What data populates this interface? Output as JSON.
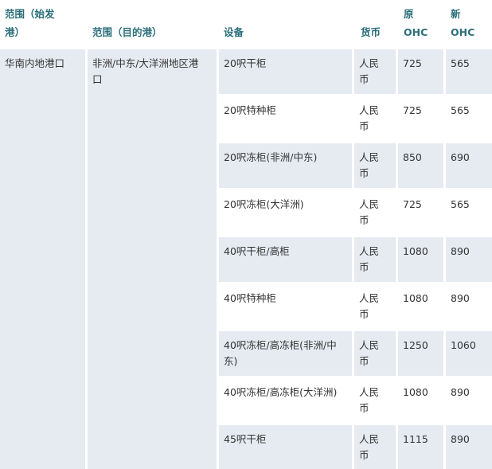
{
  "headers": {
    "origin": "范围（始发\n港）",
    "destination": "范围（目的港）",
    "equipment": "设备",
    "currency": "货币",
    "old_ohc": "原\nOHC",
    "new_ohc": "新\nOHC"
  },
  "origin_region": "华南内地港口",
  "destination_region": "非洲/中东/大洋洲地区港\n口",
  "rows": [
    {
      "equipment": "20呎干柜",
      "currency": "人民\n币",
      "old": "725",
      "new": "565"
    },
    {
      "equipment": "20呎特种柜",
      "currency": "人民\n币",
      "old": "725",
      "new": "565"
    },
    {
      "equipment": "20呎冻柜(非洲/中东)",
      "currency": "人民\n币",
      "old": "850",
      "new": "690"
    },
    {
      "equipment": "20呎冻柜(大洋洲)",
      "currency": "人民\n币",
      "old": "725",
      "new": "565"
    },
    {
      "equipment": "40呎干柜/高柜",
      "currency": "人民\n币",
      "old": "1080",
      "new": "890"
    },
    {
      "equipment": "40呎特种柜",
      "currency": "人民\n币",
      "old": "1080",
      "new": "890"
    },
    {
      "equipment": "40呎冻柜/高冻柜(非洲/中\n东)",
      "currency": "人民\n币",
      "old": "1250",
      "new": "1060"
    },
    {
      "equipment": "40呎冻柜/高冻柜(大洋洲)",
      "currency": "人民\n币",
      "old": "1080",
      "new": "890"
    },
    {
      "equipment": "45呎干柜",
      "currency": "人民\n币",
      "old": "1115",
      "new": "890"
    }
  ]
}
